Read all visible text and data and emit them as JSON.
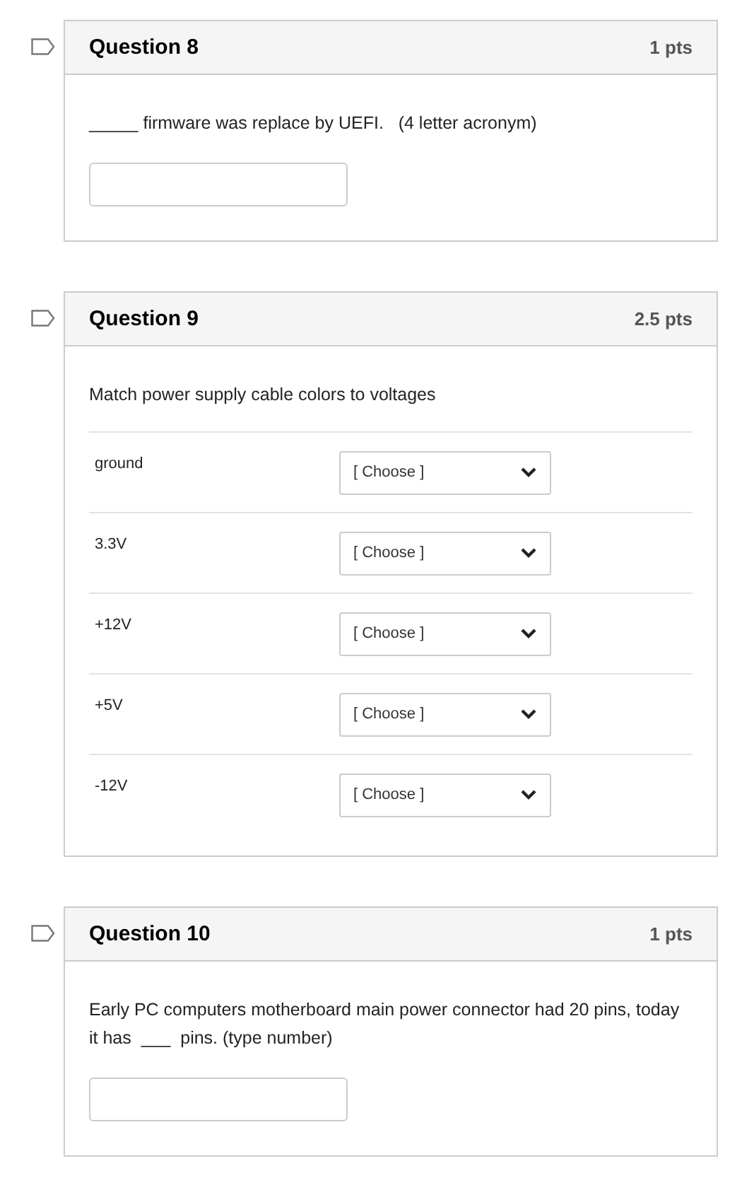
{
  "questions": [
    {
      "kind": "short_answer",
      "title": "Question 8",
      "points": "1 pts",
      "text": "_____ firmware was replace by UEFI.   (4 letter acronym)"
    },
    {
      "kind": "matching",
      "title": "Question 9",
      "points": "2.5 pts",
      "text": "Match power supply cable colors to voltages",
      "pairs": [
        {
          "label": "ground",
          "choice": "[ Choose ]"
        },
        {
          "label": "3.3V",
          "choice": "[ Choose ]"
        },
        {
          "label": "+12V",
          "choice": "[ Choose ]"
        },
        {
          "label": "+5V",
          "choice": "[ Choose ]"
        },
        {
          "label": "-12V",
          "choice": "[ Choose ]"
        }
      ]
    },
    {
      "kind": "short_answer",
      "title": "Question 10",
      "points": "1 pts",
      "text": "Early PC computers motherboard main power connector had 20 pins, today it has  ___  pins. (type number)"
    }
  ]
}
